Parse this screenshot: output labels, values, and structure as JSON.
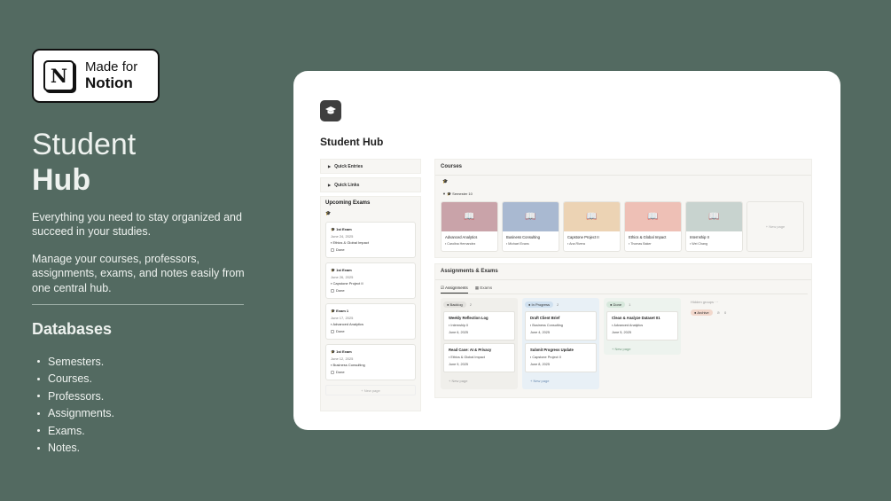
{
  "badge": {
    "line1": "Made for",
    "line2": "Notion",
    "logo_letter": "N"
  },
  "hero": {
    "title_line1": "Student",
    "title_line2": "Hub",
    "desc1": "Everything you need to stay organized and succeed in your studies.",
    "desc2": "Manage your courses, professors, assignments, exams, and notes easily from one central hub."
  },
  "databases": {
    "title": "Databases",
    "items": [
      "Semesters.",
      "Courses.",
      "Professors.",
      "Assignments.",
      "Exams.",
      "Notes."
    ]
  },
  "app": {
    "page_icon": "graduation-cap-icon",
    "page_title": "Student Hub",
    "toggles": [
      "Quick Entries",
      "Quick Links"
    ],
    "upcoming": {
      "title": "Upcoming Exams",
      "exams": [
        {
          "title": "1st Exam",
          "date": "June 24, 2025",
          "course": "Ethics & Global Impact",
          "status": "Done"
        },
        {
          "title": "1st Exam",
          "date": "June 26, 2025",
          "course": "Capstone Project II",
          "status": "Done"
        },
        {
          "title": "Exam 1",
          "date": "June 17, 2025",
          "course": "Advanced Analytics",
          "status": "Done"
        },
        {
          "title": "1st Exam",
          "date": "June 12, 2025",
          "course": "Business Consulting",
          "status": "Done"
        }
      ],
      "new_page": "+ New page"
    },
    "courses": {
      "title": "Courses",
      "semester": "Semester 10",
      "items": [
        {
          "name": "Advanced Analytics",
          "prof": "Carolina Hernandez",
          "color": "#c9a3a9",
          "icon_color": "#7a5560"
        },
        {
          "name": "Business Consulting",
          "prof": "Michael Evans",
          "color": "#a9b9d1",
          "icon_color": "#5b6e8c"
        },
        {
          "name": "Capstone Project II",
          "prof": "Ana Rivera",
          "color": "#ecd3b4",
          "icon_color": "#b08350"
        },
        {
          "name": "Ethics & Global Impact",
          "prof": "Thomas Baker",
          "color": "#eec0b6",
          "icon_color": "#b87366"
        },
        {
          "name": "Internship II",
          "prof": "Wei Chang",
          "color": "#c8d3cf",
          "icon_color": "#6b7b77"
        }
      ],
      "new_page": "+ New page"
    },
    "assignments": {
      "title": "Assignments & Exams",
      "tabs": [
        "Assignments",
        "Exams"
      ],
      "columns": [
        {
          "label": "Backlog",
          "count": "2",
          "tag_color": "#e3e2de",
          "bg": "#f0efeb",
          "cards": [
            {
              "title": "Weekly Reflection Log",
              "course": "Internship II",
              "date": "June 6, 2025"
            },
            {
              "title": "Read Case: AI & Privacy",
              "course": "Ethics & Global Impact",
              "date": "June 9, 2025"
            }
          ],
          "add": "+ New page"
        },
        {
          "label": "In Progress",
          "count": "2",
          "tag_color": "#cfe0ef",
          "bg": "#e8f0f6",
          "cards": [
            {
              "title": "Draft Client Brief",
              "course": "Business Consulting",
              "date": "June 4, 2025"
            },
            {
              "title": "Submit Progress Update",
              "course": "Capstone Project II",
              "date": "June 8, 2025"
            }
          ],
          "add": "+ New page"
        },
        {
          "label": "Done",
          "count": "1",
          "tag_color": "#d7e8dc",
          "bg": "#edf3ee",
          "cards": [
            {
              "title": "Clean & Analyze Dataset 01",
              "course": "Advanced Analytics",
              "date": "June 5, 2025"
            }
          ],
          "add": "+ New page"
        }
      ],
      "hidden_groups": "Hidden groups",
      "archive_label": "Archive",
      "archive_count": "0"
    }
  }
}
